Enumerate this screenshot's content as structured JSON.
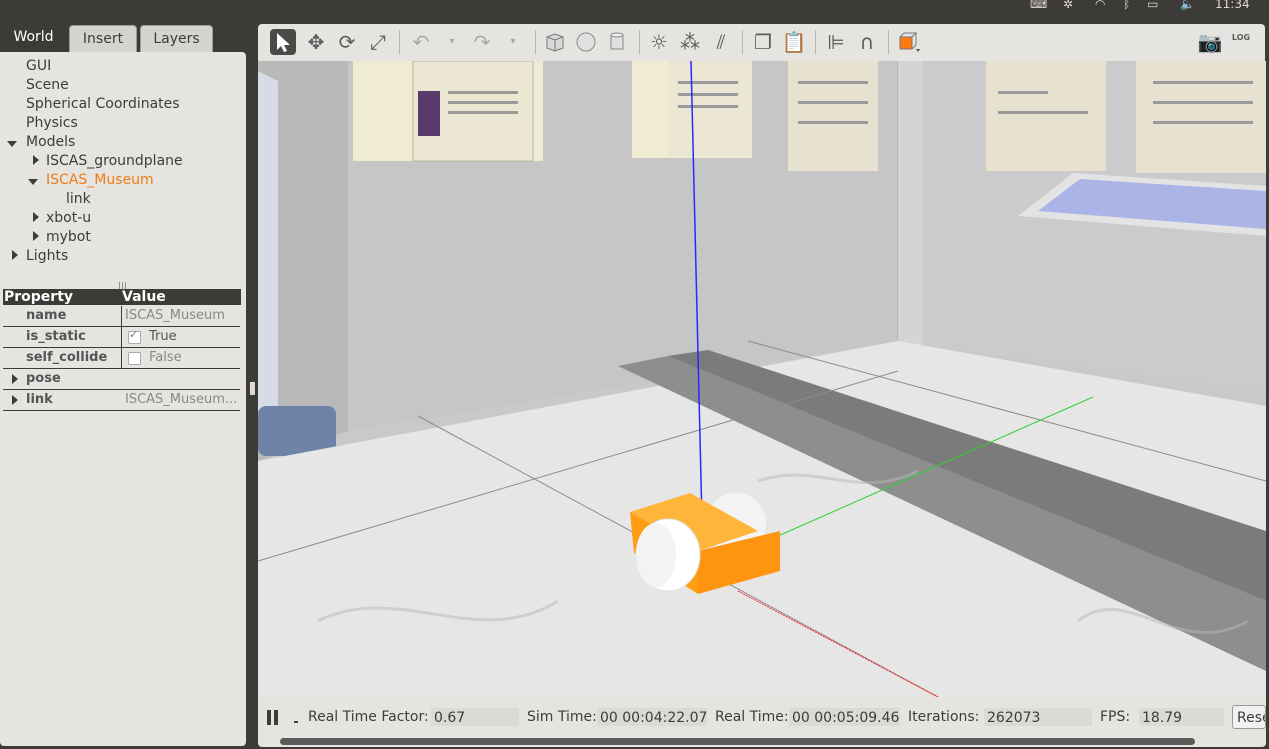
{
  "system": {
    "clock": "11:34"
  },
  "left_tabs": [
    {
      "label": "World"
    },
    {
      "label": "Insert"
    },
    {
      "label": "Layers"
    }
  ],
  "world_tree": {
    "items": [
      {
        "label": "GUI"
      },
      {
        "label": "Scene"
      },
      {
        "label": "Spherical Coordinates"
      },
      {
        "label": "Physics"
      },
      {
        "label": "Models"
      },
      {
        "label": "ISCAS_groundplane"
      },
      {
        "label": "ISCAS_Museum"
      },
      {
        "label": "link"
      },
      {
        "label": "xbot-u"
      },
      {
        "label": "mybot"
      },
      {
        "label": "Lights"
      }
    ],
    "selected": "ISCAS_Museum"
  },
  "properties": {
    "header_property": "Property",
    "header_value": "Value",
    "rows": [
      {
        "key": "name",
        "value": "ISCAS_Museum"
      },
      {
        "key": "is_static",
        "value": "True",
        "checked": true
      },
      {
        "key": "self_collide",
        "value": "False",
        "checked": false
      },
      {
        "key": "pose",
        "value": ""
      },
      {
        "key": "link",
        "value": "ISCAS_Museum..."
      }
    ]
  },
  "toolbar": {
    "icons": [
      "select-mode-icon",
      "translate-mode-icon",
      "rotate-mode-icon",
      "scale-mode-icon",
      "undo-icon",
      "undo-dropdown-icon",
      "redo-icon",
      "redo-dropdown-icon",
      "box-shape-icon",
      "sphere-shape-icon",
      "cylinder-shape-icon",
      "point-light-icon",
      "spot-light-icon",
      "directional-light-icon",
      "copy-icon",
      "paste-icon",
      "align-icon",
      "snap-icon",
      "view-angle-icon",
      "screenshot-icon",
      "log-icon"
    ],
    "log_label": "LOG"
  },
  "stats": {
    "real_time_factor_label": "Real Time Factor:",
    "real_time_factor": "0.67",
    "sim_time_label": "Sim Time:",
    "sim_time": "00 00:04:22.073",
    "real_time_label": "Real Time:",
    "real_time": "00 00:05:09.460",
    "iterations_label": "Iterations:",
    "iterations": "262073",
    "fps_label": "FPS:",
    "fps": "18.79",
    "reset_label": "Rese"
  },
  "colors": {
    "robot": "#ff9e13",
    "selected_item": "#f07b16",
    "panel_bg": "#e6e4e0",
    "dark_bg": "#3c3b37"
  }
}
